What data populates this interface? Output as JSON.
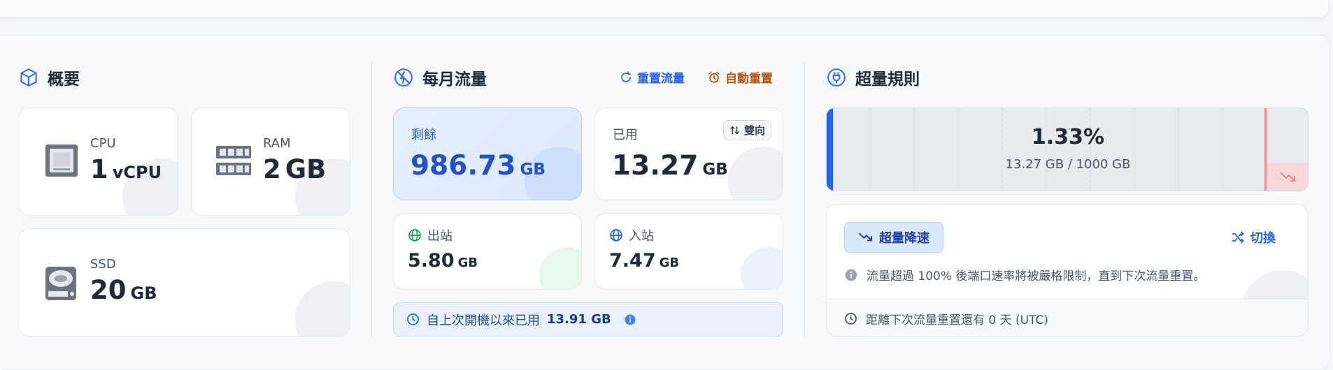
{
  "overview": {
    "title": "概要",
    "cpu": {
      "label": "CPU",
      "value": "1",
      "unit": "vCPU"
    },
    "ram": {
      "label": "RAM",
      "value": "2",
      "unit": "GB"
    },
    "ssd": {
      "label": "SSD",
      "value": "20",
      "unit": "GB"
    }
  },
  "traffic": {
    "title": "每月流量",
    "reset_label": "重置流量",
    "auto_reset_label": "自動重置",
    "remaining": {
      "label": "剩餘",
      "value": "986.73",
      "unit": "GB"
    },
    "used": {
      "label": "已用",
      "value": "13.27",
      "unit": "GB",
      "mode_label": "雙向"
    },
    "outbound": {
      "label": "出站",
      "value": "5.80",
      "unit": "GB"
    },
    "inbound": {
      "label": "入站",
      "value": "7.47",
      "unit": "GB"
    },
    "since_boot": {
      "text": "自上次開機以來已用",
      "value": "13.91 GB"
    }
  },
  "overage": {
    "title": "超量規則",
    "percent": "1.33%",
    "usage_text": "13.27 GB / 1000 GB",
    "usage_fraction": 0.0133,
    "rule_label": "超量降速",
    "switch_label": "切換",
    "description": "流量超過 100% 後端口速率將被嚴格限制，直到下次流量重置。",
    "next_reset": "距離下次流量重置還有 0 天 (UTC)"
  },
  "colors": {
    "accent_blue": "#2563eb",
    "reset_orange": "#b45309",
    "green": "#16a34a"
  }
}
